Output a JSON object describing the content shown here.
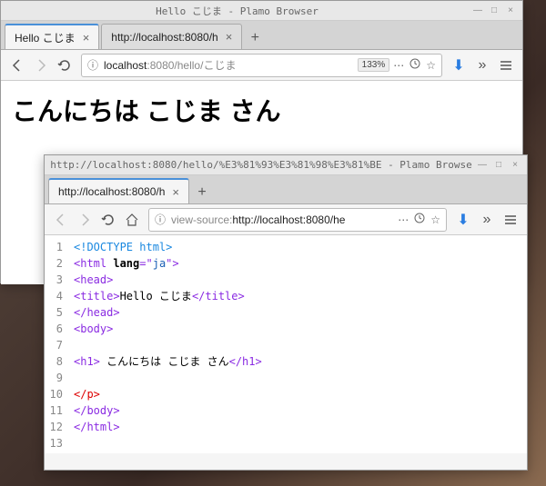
{
  "desktop": {},
  "window1": {
    "title": "Hello こじま - Plamo Browser",
    "tabs": [
      {
        "label": "Hello こじま",
        "active": true
      },
      {
        "label": "http://localhost:8080/h",
        "active": false
      }
    ],
    "url": {
      "host": "localhost",
      "port": ":8080",
      "path": "/hello/こじま",
      "zoom": "133%"
    },
    "page": {
      "heading": "こんにちは こじま さん"
    }
  },
  "window2": {
    "title": "http://localhost:8080/hello/%E3%81%93%E3%81%98%E3%81%BE - Plamo Browse",
    "tabs": [
      {
        "label": "http://localhost:8080/h",
        "active": true
      }
    ],
    "url": {
      "prefix": "view-source:",
      "full": "http://localhost:8080/he"
    },
    "source": {
      "lines": [
        {
          "n": 1,
          "kind": "doctype",
          "raw": "<!DOCTYPE html>"
        },
        {
          "n": 2,
          "kind": "tag-attr",
          "open": "<html ",
          "attr": "lang",
          "eq": "=\"",
          "val": "ja",
          "close": "\">"
        },
        {
          "n": 3,
          "kind": "tag",
          "raw": "<head>"
        },
        {
          "n": 4,
          "kind": "tag-text",
          "open": "<title>",
          "text": "Hello こじま",
          "close": "</title>"
        },
        {
          "n": 5,
          "kind": "tag",
          "raw": "</head>"
        },
        {
          "n": 6,
          "kind": "tag",
          "raw": "<body>"
        },
        {
          "n": 7,
          "kind": "blank",
          "raw": ""
        },
        {
          "n": 8,
          "kind": "tag-text",
          "open": "<h1>",
          "text": " こんにちは こじま さん",
          "close": "</h1>"
        },
        {
          "n": 9,
          "kind": "blank",
          "raw": ""
        },
        {
          "n": 10,
          "kind": "tag-red",
          "raw": "</p>"
        },
        {
          "n": 11,
          "kind": "tag",
          "raw": "</body>"
        },
        {
          "n": 12,
          "kind": "tag",
          "raw": "</html>"
        },
        {
          "n": 13,
          "kind": "blank",
          "raw": ""
        }
      ]
    }
  },
  "icons": {
    "min": "—",
    "max": "□",
    "close": "×",
    "plus": "+"
  }
}
